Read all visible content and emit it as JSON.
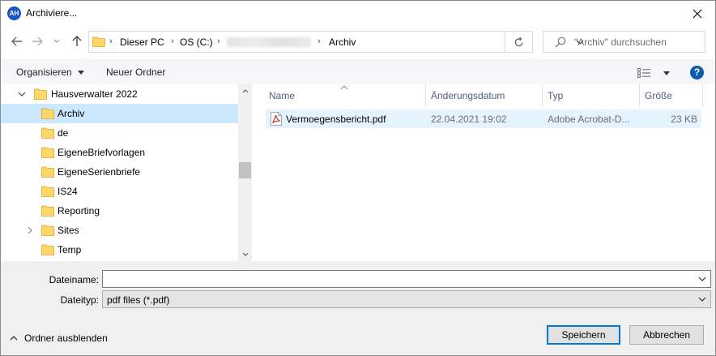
{
  "window": {
    "app_icon_text": "AH",
    "title": "Archiviere..."
  },
  "address": {
    "crumbs": [
      "Dieser PC",
      "OS (C:)",
      "Archiv"
    ],
    "search_placeholder": "\"Archiv\" durchsuchen"
  },
  "toolbar": {
    "organize_label": "Organisieren",
    "new_folder_label": "Neuer Ordner",
    "help_label": "?"
  },
  "tree": {
    "items": [
      {
        "label": "Hausverwalter 2022",
        "expanded": true
      },
      {
        "label": "Archiv",
        "selected": true
      },
      {
        "label": "de"
      },
      {
        "label": "EigeneBriefvorlagen"
      },
      {
        "label": "EigeneSerienbriefe"
      },
      {
        "label": "IS24"
      },
      {
        "label": "Reporting"
      },
      {
        "label": "Sites",
        "has_children": true
      },
      {
        "label": "Temp"
      }
    ]
  },
  "filelist": {
    "columns": [
      "Name",
      "Änderungsdatum",
      "Typ",
      "Größe"
    ],
    "rows": [
      {
        "name": "Vermoegensbericht.pdf",
        "date": "22.04.2021 19:02",
        "type": "Adobe Acrobat-D...",
        "size": "23 KB",
        "icon": "pdf-icon"
      }
    ]
  },
  "bottom": {
    "filename_label": "Dateiname:",
    "filename_value": "",
    "filetype_label": "Dateityp:",
    "filetype_value": "pdf files (*.pdf)",
    "hide_folders_label": "Ordner ausblenden",
    "save_label": "Speichern",
    "cancel_label": "Abbrechen"
  },
  "colors": {
    "selection": "#cce8ff",
    "row_hover": "#e5f3ff",
    "accent": "#0078d7",
    "folder": "#ffd766"
  }
}
